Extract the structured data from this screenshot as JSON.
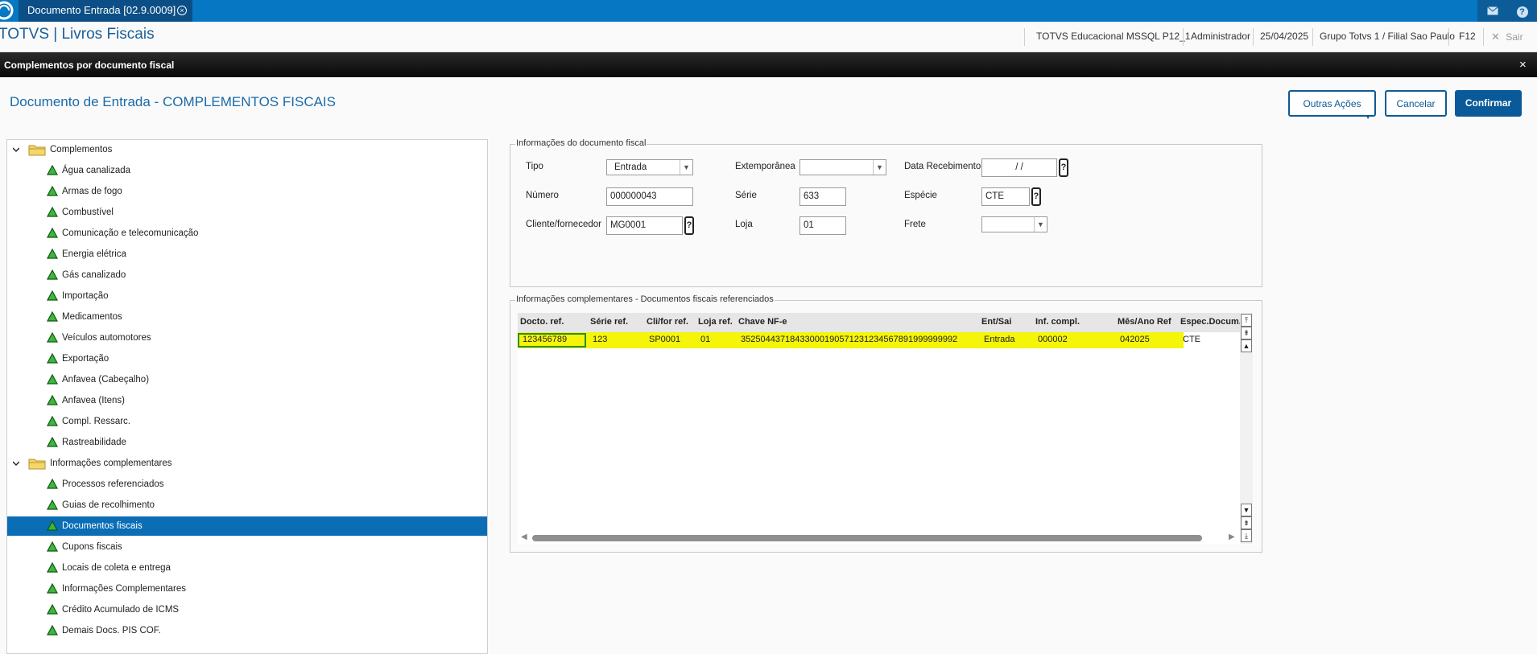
{
  "topbar": {
    "tab_title": "Documento Entrada [02.9.0009]",
    "close_glyph": "×",
    "mail_icon": "envelope-icon",
    "help_icon": "question-icon",
    "help_glyph": "?"
  },
  "header": {
    "app_title": "TOTVS | Livros Fiscais",
    "environment": "TOTVS Educacional MSSQL P12_1",
    "user": "Administrador",
    "date": "25/04/2025",
    "branch": "Grupo Totvs 1 / Filial Sao Paulo",
    "f12": "F12",
    "exit_label": "Sair",
    "exit_glyph": "✕"
  },
  "dialog": {
    "title": "Complementos por documento fiscal",
    "close_glyph": "×"
  },
  "page": {
    "title": "Documento de Entrada - COMPLEMENTOS FISCAIS"
  },
  "buttons": {
    "more": "Outras Ações",
    "cancel": "Cancelar",
    "confirm": "Confirmar"
  },
  "tree": {
    "groups": [
      {
        "label": "Complementos",
        "children": [
          "Água canalizada",
          "Armas de fogo",
          "Combustível",
          "Comunicação e telecomunicação",
          "Energia elétrica",
          "Gás canalizado",
          "Importação",
          "Medicamentos",
          "Veículos automotores",
          "Exportação",
          "Anfavea (Cabeçalho)",
          "Anfavea (Itens)",
          "Compl. Ressarc.",
          "Rastreabilidade"
        ]
      },
      {
        "label": "Informações complementares",
        "children": [
          "Processos referenciados",
          "Guias de recolhimento",
          "Documentos fiscais",
          "Cupons fiscais",
          "Locais de coleta e entrega",
          "Informações Complementares",
          "Crédito Acumulado de ICMS",
          "Demais Docs. PIS COF."
        ]
      }
    ],
    "selected": "Documentos fiscais"
  },
  "doc_info": {
    "legend": "Informações do documento fiscal",
    "tipo_label": "Tipo",
    "tipo_value": "Entrada",
    "extemporanea_label": "Extemporânea",
    "extemporanea_value": "",
    "data_recebimento_label": "Data Recebimento",
    "data_recebimento_value": "/ /",
    "numero_label": "Número",
    "numero_value": "000000043",
    "serie_label": "Série",
    "serie_value": "633",
    "especie_label": "Espécie",
    "especie_value": "CTE",
    "cliente_label": "Cliente/fornecedor",
    "cliente_value": "MG0001",
    "loja_label": "Loja",
    "loja_value": "01",
    "frete_label": "Frete",
    "frete_value": "",
    "lookup_glyph": "?"
  },
  "referenced_docs": {
    "legend": "Informações complementares - Documentos fiscais referenciados",
    "columns": [
      "Docto. ref.",
      "Série ref.",
      "Cli/for ref.",
      "Loja ref.",
      "Chave NF-e",
      "Ent/Sai",
      "Inf. compl.",
      "Mês/Ano Ref",
      "Espec.Docum."
    ],
    "rows": [
      [
        "123456789",
        "123",
        "SP0001",
        "01",
        "35250443718433000190571231234567891999999992",
        "Entrada",
        "000002",
        "042025",
        "CTE"
      ]
    ]
  }
}
